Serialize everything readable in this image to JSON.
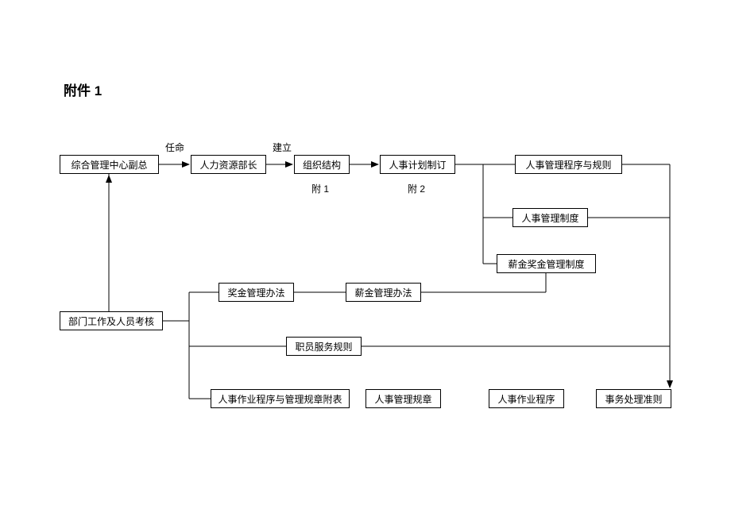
{
  "title": "附件 1",
  "labels": {
    "appoint": "任命",
    "establish": "建立",
    "annex1": "附 1",
    "annex2": "附 2"
  },
  "boxes": {
    "general_mgmt": "综合管理中心副总",
    "hr_director": "人力资源部长",
    "org_structure": "组织结构",
    "hr_plan": "人事计划制订",
    "hr_mgmt_proc_rules": "人事管理程序与规则",
    "hr_mgmt_system": "人事管理制度",
    "salary_bonus_system": "薪金奖金管理制度",
    "bonus_mgmt": "奖金管理办法",
    "salary_mgmt": "薪金管理办法",
    "dept_assess": "部门工作及人员考核",
    "staff_rules": "职员服务规则",
    "hr_ops_attach": "人事作业程序与管理规章附表",
    "hr_mgmt_reg": "人事管理规章",
    "hr_ops_proc": "人事作业程序",
    "affairs_guidelines": "事务处理准则"
  }
}
